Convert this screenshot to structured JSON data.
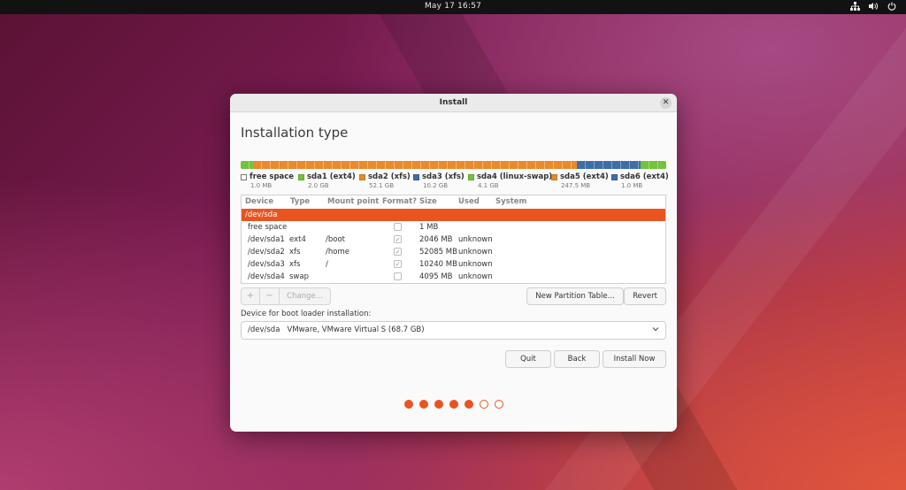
{
  "topbar": {
    "clock": "May 17  16:57",
    "tray_icons": [
      "network-icon",
      "volume-icon",
      "power-icon"
    ]
  },
  "window": {
    "title": "Install",
    "heading": "Installation type"
  },
  "partition_bar": [
    {
      "name": "free space",
      "color": "#ffffff",
      "fraction": 0.0
    },
    {
      "name": "sda1",
      "color": "#73c33b",
      "fraction": 0.03
    },
    {
      "name": "sda2",
      "color": "#e98a2b",
      "fraction": 0.76
    },
    {
      "name": "sda3",
      "color": "#3d6ea8",
      "fraction": 0.15
    },
    {
      "name": "sda4",
      "color": "#73c33b",
      "fraction": 0.06
    }
  ],
  "legend": [
    {
      "label": "free space",
      "size": "1.0 MB",
      "color": "#ffffff"
    },
    {
      "label": "sda1 (ext4)",
      "size": "2.0 GB",
      "color": "#73c33b"
    },
    {
      "label": "sda2 (xfs)",
      "size": "52.1 GB",
      "color": "#e98a2b"
    },
    {
      "label": "sda3 (xfs)",
      "size": "10.2 GB",
      "color": "#3d6ea8"
    },
    {
      "label": "sda4 (linux-swap)",
      "size": "4.1 GB",
      "color": "#73c33b"
    },
    {
      "label": "sda5 (ext4)",
      "size": "247.5 MB",
      "color": "#e98a2b"
    },
    {
      "label": "sda6 (ext4)",
      "size": "1.0 MB",
      "color": "#3d6ea8"
    }
  ],
  "table": {
    "headers": [
      "Device",
      "Type",
      "Mount point",
      "Format?",
      "Size",
      "Used",
      "System"
    ],
    "rows": [
      {
        "device": "/dev/sda",
        "type": "",
        "mount": "",
        "format": null,
        "size": "",
        "used": "",
        "system": ""
      },
      {
        "device": "free space",
        "type": "",
        "mount": "",
        "format": false,
        "size": "1 MB",
        "used": "",
        "system": ""
      },
      {
        "device": "/dev/sda1",
        "type": "ext4",
        "mount": "/boot",
        "format": true,
        "size": "2046 MB",
        "used": "unknown",
        "system": ""
      },
      {
        "device": "/dev/sda2",
        "type": "xfs",
        "mount": "/home",
        "format": true,
        "size": "52085 MB",
        "used": "unknown",
        "system": ""
      },
      {
        "device": "/dev/sda3",
        "type": "xfs",
        "mount": "/",
        "format": true,
        "size": "10240 MB",
        "used": "unknown",
        "system": ""
      },
      {
        "device": "/dev/sda4",
        "type": "swap",
        "mount": "",
        "format": false,
        "size": "4095 MB",
        "used": "unknown",
        "system": ""
      }
    ]
  },
  "toolbar": {
    "add": "+",
    "remove": "−",
    "change": "Change...",
    "new_table": "New Partition Table...",
    "revert": "Revert"
  },
  "boot": {
    "label": "Device for boot loader installation:",
    "selected": "/dev/sda   VMware, VMware Virtual S (68.7 GB)"
  },
  "actions": {
    "quit": "Quit",
    "back": "Back",
    "install": "Install Now"
  },
  "progress": {
    "total_steps": 7,
    "completed_steps": 5
  },
  "colors": {
    "accent": "#e95420"
  }
}
